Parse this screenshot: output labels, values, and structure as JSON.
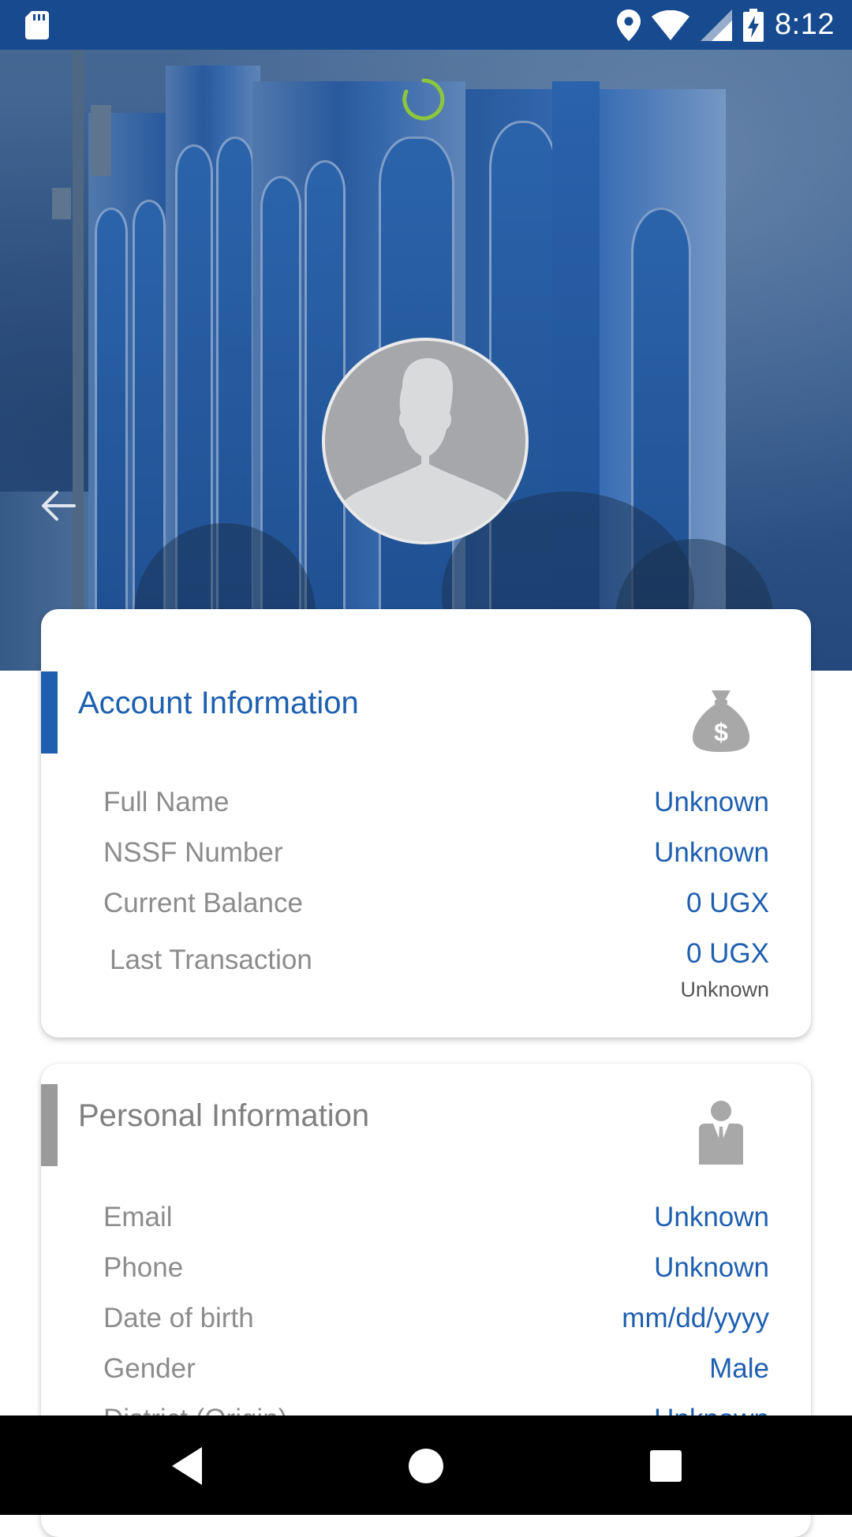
{
  "status_bar": {
    "time": "8:12",
    "icons": [
      "sd-card-icon",
      "location-icon",
      "wifi-icon",
      "signal-icon",
      "battery-charging-icon"
    ]
  },
  "hero": {
    "background": "office-building-photo",
    "loading": true,
    "back_icon": "arrow-left-icon",
    "avatar_icon": "default-person-avatar"
  },
  "account_card": {
    "title": "Account Information",
    "icon": "money-bag-icon",
    "accent_color": "#1f5fb0",
    "rows": [
      {
        "label": "Full Name",
        "value": "Unknown"
      },
      {
        "label": "NSSF Number",
        "value": "Unknown"
      },
      {
        "label": "Current Balance",
        "value": "0 UGX"
      },
      {
        "label": "Last Transaction",
        "value": "0 UGX",
        "sub": "Unknown"
      }
    ]
  },
  "personal_card": {
    "title": "Personal Information",
    "icon": "businessman-icon",
    "accent_color": "#9a9a9a",
    "rows": [
      {
        "label": "Email",
        "value": "Unknown"
      },
      {
        "label": "Phone",
        "value": "Unknown"
      },
      {
        "label": "Date of birth",
        "value": "mm/dd/yyyy"
      },
      {
        "label": "Gender",
        "value": "Male"
      },
      {
        "label": "District (Origin)",
        "value": "Unknown"
      }
    ]
  },
  "nav_bar": {
    "buttons": [
      "back-triangle-icon",
      "home-circle-icon",
      "recents-square-icon"
    ]
  }
}
